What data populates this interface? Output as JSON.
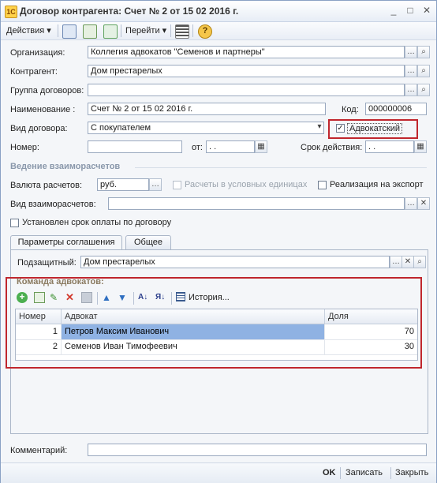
{
  "window": {
    "title": "Договор контрагента: Счет № 2 от 15 02 2016 г."
  },
  "toolbar": {
    "actions_label": "Действия",
    "goto_label": "Перейти"
  },
  "form": {
    "org_label": "Организация:",
    "org_value": "Коллегия адвокатов \"Семенов и партнеры\"",
    "contractor_label": "Контрагент:",
    "contractor_value": "Дом престарелых",
    "group_label": "Группа договоров:",
    "group_value": "",
    "name_label": "Наименование :",
    "name_value": "Счет № 2 от 15 02 2016 г.",
    "code_label": "Код:",
    "code_value": "000000006",
    "type_label": "Вид договора:",
    "type_value": "С покупателем",
    "advocate_label": "Адвокатский",
    "advocate_checked": true,
    "number_label": "Номер:",
    "number_value": "",
    "from_label": "от:",
    "from_value": " .  .",
    "term_label": "Срок действия:",
    "term_value": " .  .",
    "section_settlements": "Ведение взаиморасчетов",
    "currency_label": "Валюта расчетов:",
    "currency_value": "руб.",
    "conditional_units_label": "Расчеты в условных единицах",
    "export_label": "Реализация на экспорт",
    "settlement_type_label": "Вид взаиморасчетов:",
    "settlement_type_value": "",
    "payment_term_label": "Установлен срок оплаты по договору",
    "comment_label": "Комментарий:",
    "comment_value": ""
  },
  "tabs": [
    {
      "label": "Параметры соглашения",
      "active": true
    },
    {
      "label": "Общее",
      "active": false
    }
  ],
  "agreement": {
    "client_label": "Подзащитный:",
    "client_value": "Дом престарелых",
    "team_label": "Команда адвокатов:",
    "history_label": "История...",
    "columns": [
      "Номер",
      "Адвокат",
      "Доля"
    ],
    "rows": [
      {
        "num": "1",
        "lawyer": "Петров Максим Иванович",
        "share": "70"
      },
      {
        "num": "2",
        "lawyer": "Семенов Иван Тимофеевич",
        "share": "30"
      }
    ]
  },
  "bottom": {
    "ok_label": "OK",
    "save_label": "Записать",
    "close_label": "Закрыть"
  },
  "colors": {
    "highlight_border": "#c0262d",
    "selected_row": "#8fb2e3",
    "section_text": "#8a98ab"
  }
}
